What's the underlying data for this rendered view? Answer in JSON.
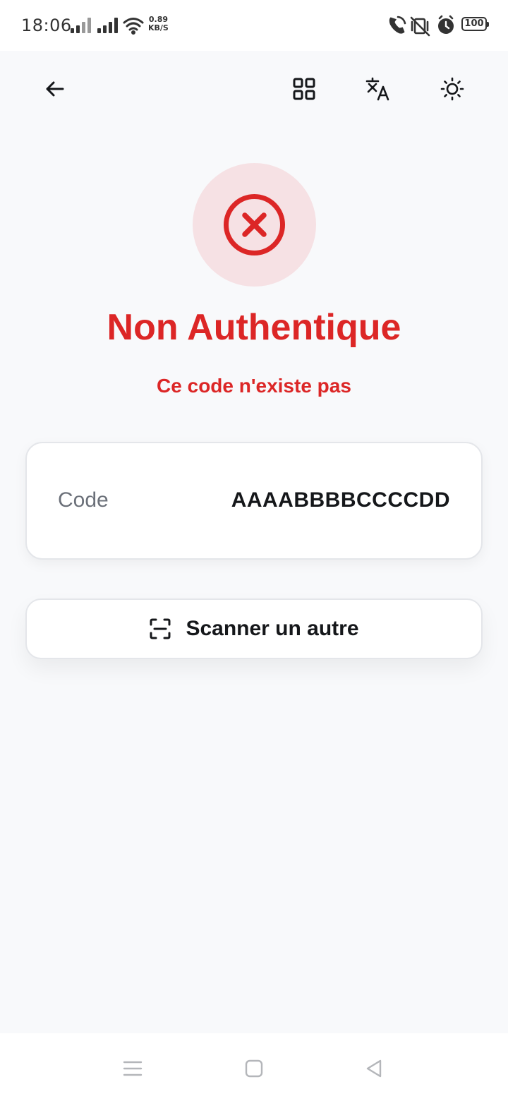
{
  "status_bar": {
    "time": "18:06",
    "net_speed_value": "0.89",
    "net_speed_unit": "KB/S",
    "battery": "100"
  },
  "toolbar": {
    "back_icon": "arrow-left-icon",
    "grid_icon": "grid-icon",
    "translate_icon": "translate-icon",
    "theme_icon": "sun-icon"
  },
  "result": {
    "icon": "x-circle-icon",
    "title": "Non Authentique",
    "message": "Ce code n'existe pas",
    "accent_color": "#dc2626",
    "circle_bg": "#f6e1e4"
  },
  "code_card": {
    "label": "Code",
    "value": "AAAABBBBCCCCDD"
  },
  "scan_button": {
    "icon": "scan-icon",
    "label": "Scanner un autre"
  },
  "nav_bar": {
    "menu_icon": "menu-icon",
    "home_icon": "square-icon",
    "back_icon": "triangle-back-icon"
  }
}
